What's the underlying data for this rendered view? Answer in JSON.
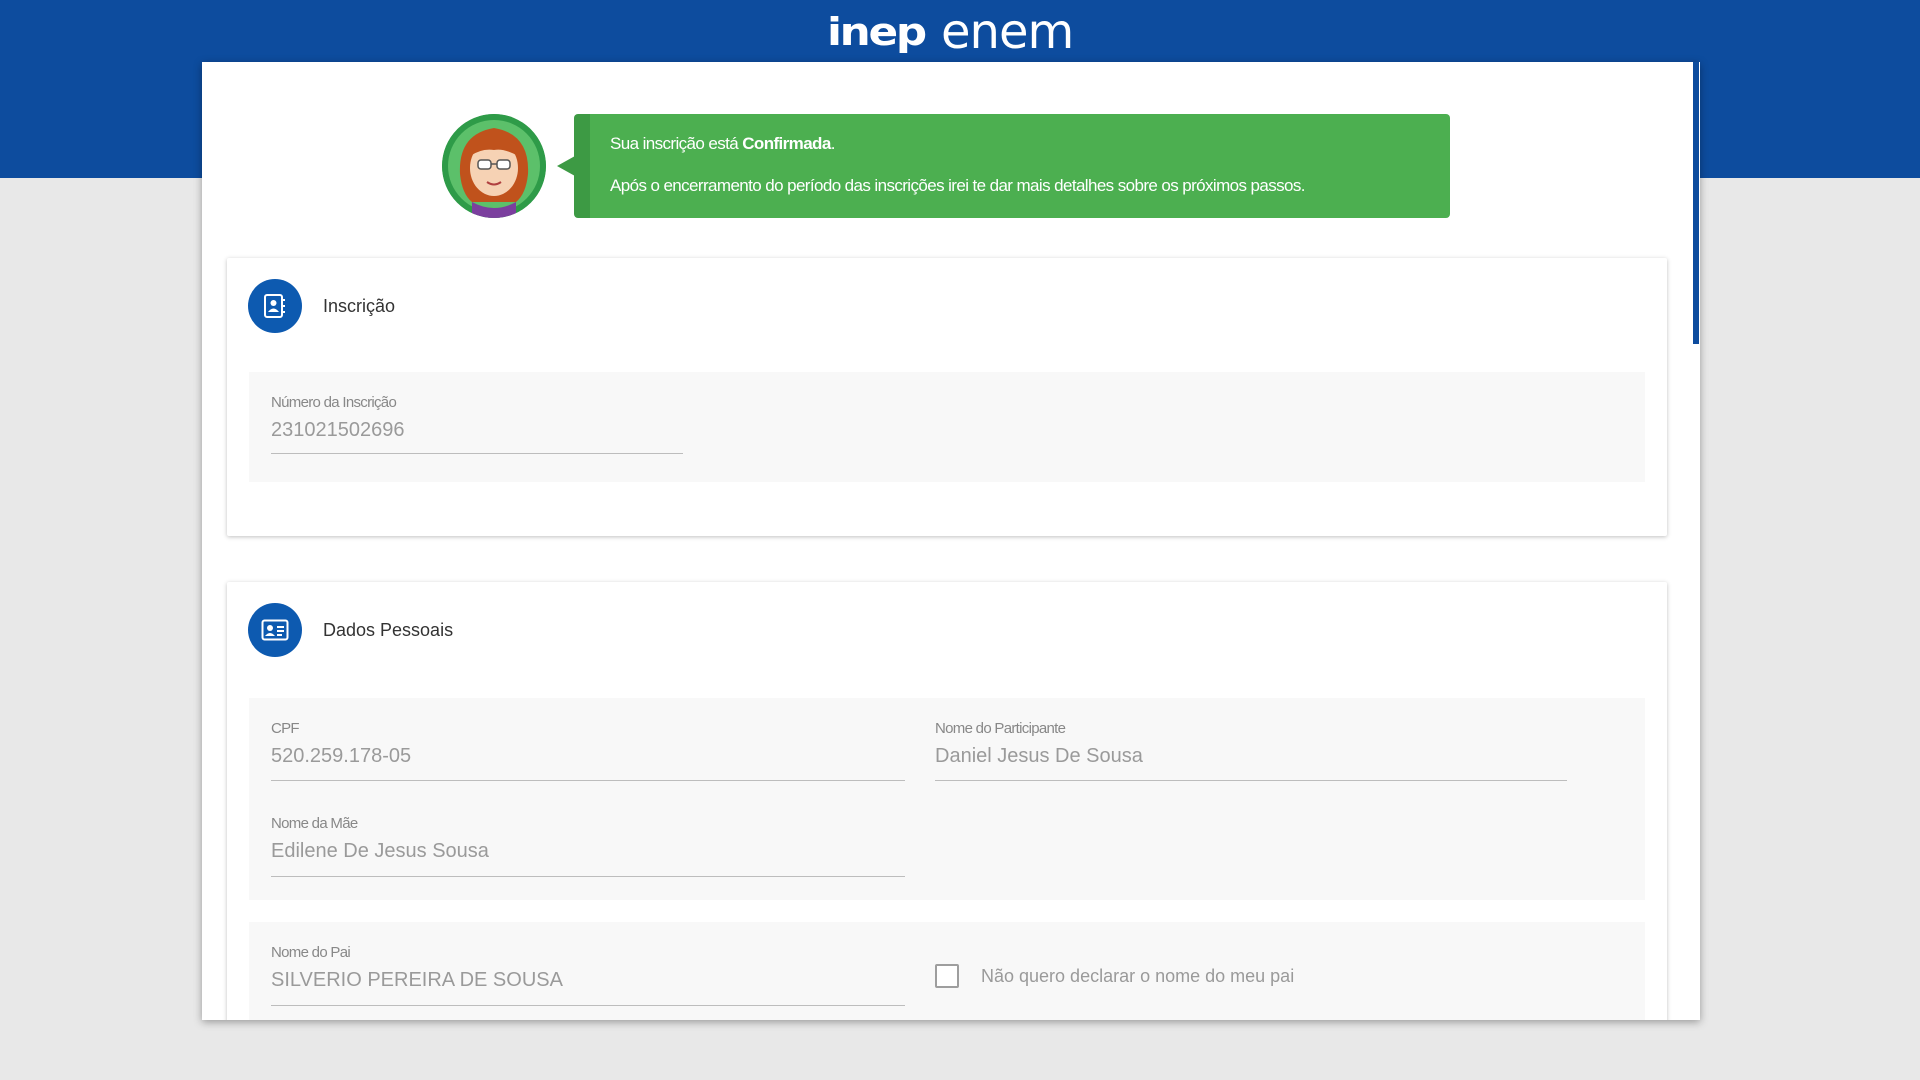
{
  "header": {
    "logo_inep": "inep",
    "logo_enem": "enem"
  },
  "message": {
    "line1_prefix": "Sua inscrição está ",
    "line1_status": "Confirmada",
    "line1_suffix": ".",
    "line2": "Após o encerramento do período das inscrições irei te dar mais detalhes sobre os próximos passos."
  },
  "inscricao": {
    "title": "Inscrição",
    "numero_label": "Número da Inscrição",
    "numero_value": "231021502696"
  },
  "dados_pessoais": {
    "title": "Dados Pessoais",
    "cpf_label": "CPF",
    "cpf_value": "520.259.178-05",
    "nome_participante_label": "Nome do Participante",
    "nome_participante_value": "Daniel Jesus De Sousa",
    "nome_mae_label": "Nome da Mãe",
    "nome_mae_value": "Edilene De Jesus Sousa",
    "nome_pai_label": "Nome do Pai",
    "nome_pai_value": "SILVERIO PEREIRA DE SOUSA",
    "nao_declarar_pai_label": "Não quero declarar o nome do meu pai"
  },
  "colors": {
    "brand_blue": "#0d4c9e",
    "success_green": "#4caf50"
  },
  "icons": {
    "inscricao": "contact-book-icon",
    "dados_pessoais": "id-card-icon",
    "avatar": "assistant-avatar"
  }
}
